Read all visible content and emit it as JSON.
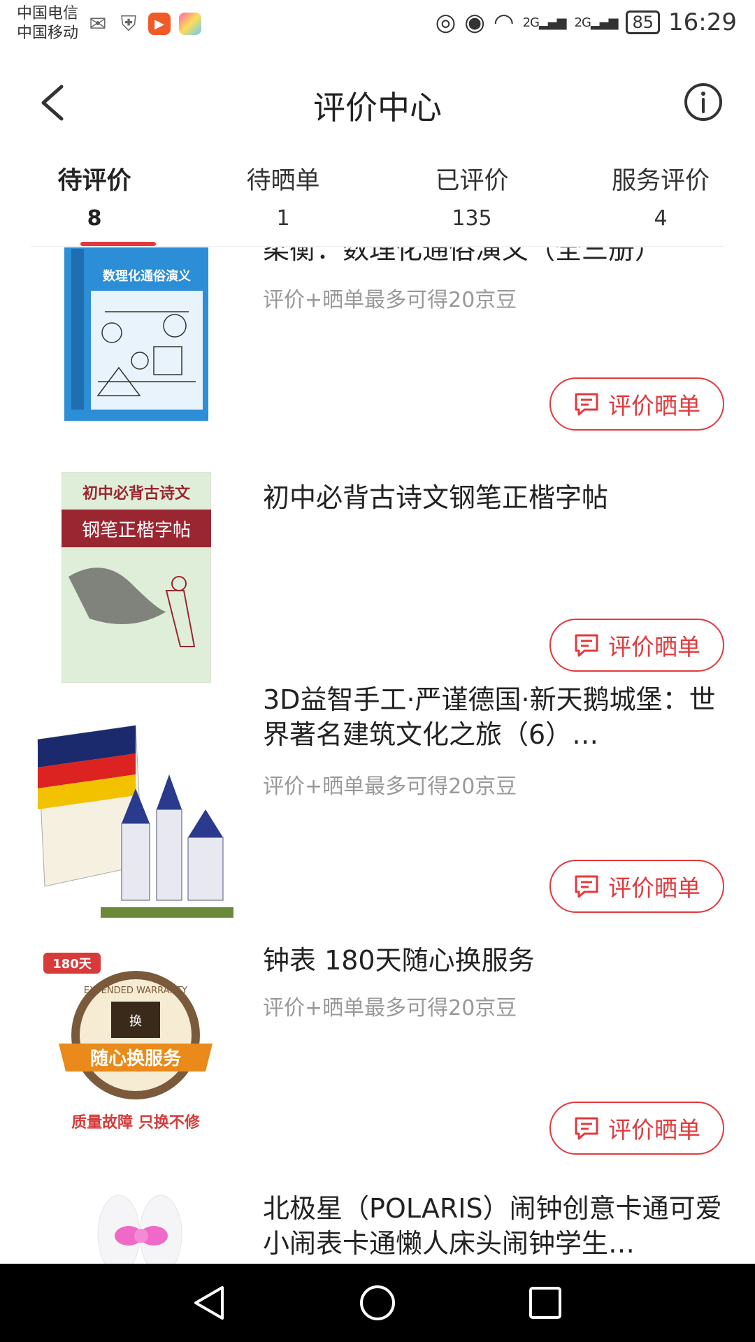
{
  "status_bar": {
    "carrier1": "中国电信",
    "carrier2": "中国移动",
    "signal1": "2G",
    "signal2": "2G",
    "battery": "85",
    "time": "16:29"
  },
  "header": {
    "title": "评价中心"
  },
  "tabs": [
    {
      "label": "待评价",
      "count": "8"
    },
    {
      "label": "待晒单",
      "count": "1"
    },
    {
      "label": "已评价",
      "count": "135"
    },
    {
      "label": "服务评价",
      "count": "4"
    }
  ],
  "items": [
    {
      "title": "柔衡：数理化通俗演义（全三册）",
      "subtitle": "评价+晒单最多可得20京豆",
      "button": "评价晒单",
      "thumb_text": "数理化通俗演义"
    },
    {
      "title": "初中必背古诗文钢笔正楷字帖",
      "subtitle": "",
      "button": "评价晒单",
      "thumb_text1": "初中必背古诗文",
      "thumb_text2": "钢笔正楷字帖"
    },
    {
      "title": "3D益智手工·严谨德国·新天鹅城堡：世界著名建筑文化之旅（6）…",
      "subtitle": "评价+晒单最多可得20京豆",
      "button": "评价晒单"
    },
    {
      "title": "钟表 180天随心换服务",
      "subtitle": "评价+晒单最多可得20京豆",
      "button": "评价晒单",
      "thumb_badge": "180天",
      "thumb_banner": "随心换服务",
      "thumb_caption": "质量故障 只换不修",
      "thumb_ring": "EXTENDED WARRANTY",
      "thumb_box": "换"
    },
    {
      "title": "北极星（POLARIS）闹钟创意卡通可爱小闹表卡通懒人床头闹钟学生…",
      "subtitle": "",
      "button": ""
    }
  ],
  "colors": {
    "accent": "#e4393c",
    "muted": "#999999"
  }
}
